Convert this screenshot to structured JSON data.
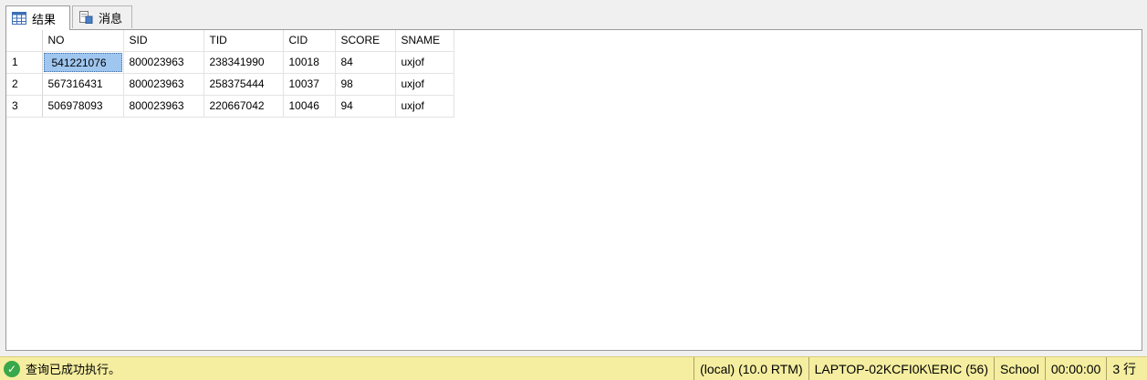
{
  "tabs": [
    {
      "label": "结果",
      "icon": "grid-icon",
      "active": true
    },
    {
      "label": "消息",
      "icon": "messages-icon",
      "active": false
    }
  ],
  "results": {
    "columns": [
      "NO",
      "SID",
      "TID",
      "CID",
      "SCORE",
      "SNAME"
    ],
    "rows": [
      {
        "num": "1",
        "cells": [
          "541221076",
          "800023963",
          "238341990",
          "10018",
          "84",
          "uxjof"
        ]
      },
      {
        "num": "2",
        "cells": [
          "567316431",
          "800023963",
          "258375444",
          "10037",
          "98",
          "uxjof"
        ]
      },
      {
        "num": "3",
        "cells": [
          "506978093",
          "800023963",
          "220667042",
          "10046",
          "94",
          "uxjof"
        ]
      }
    ]
  },
  "status": {
    "message": "查询已成功执行。",
    "server": "(local) (10.0 RTM)",
    "user": "LAPTOP-02KCFI0K\\ERIC (56)",
    "database": "School",
    "elapsed": "00:00:00",
    "rowcount": "3 行",
    "colors": {
      "bar": "#f5eea0",
      "ok": "#3aa84a",
      "selection": "#9fc6ef"
    }
  }
}
